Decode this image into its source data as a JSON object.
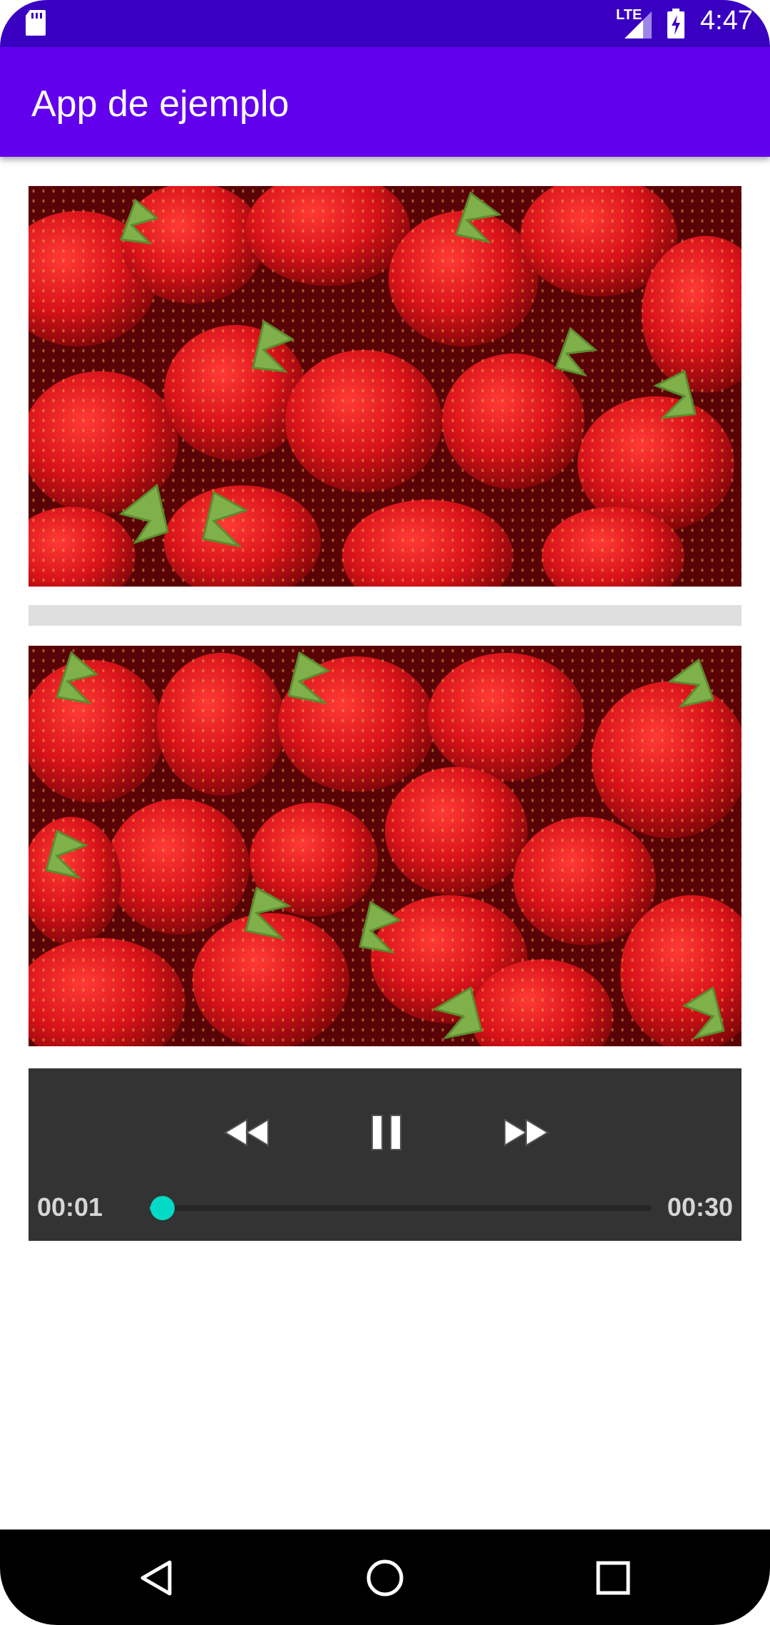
{
  "status_bar": {
    "network": "LTE",
    "time": "4:47",
    "icons": [
      "sd-card-icon",
      "signal-icon",
      "battery-charging-icon"
    ]
  },
  "app_bar": {
    "title": "App de ejemplo",
    "color": "#6200ee"
  },
  "images": [
    {
      "name": "strawberries-image-1",
      "subject": "strawberries"
    },
    {
      "name": "strawberries-image-2",
      "subject": "strawberries"
    }
  ],
  "media_controller": {
    "buttons": [
      "rewind-icon",
      "pause-icon",
      "fast-forward-icon"
    ],
    "current_time": "00:01",
    "total_time": "00:30",
    "progress_fraction": 0.025,
    "accent_color": "#03dac5"
  },
  "nav_bar": {
    "buttons": [
      "back-icon",
      "home-icon",
      "recents-icon"
    ]
  }
}
